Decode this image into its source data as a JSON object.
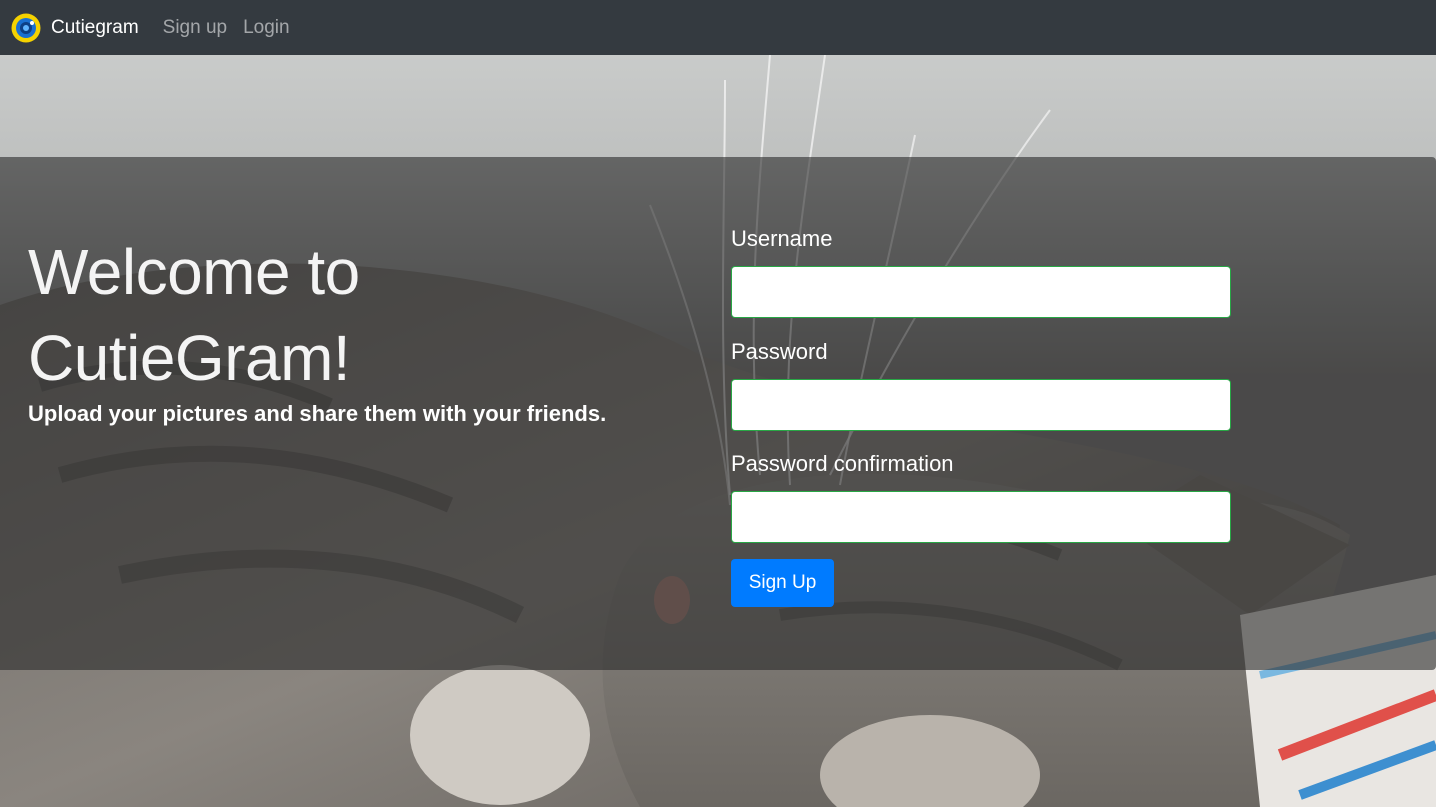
{
  "navbar": {
    "brand": "Cutiegram",
    "links": [
      "Sign up",
      "Login"
    ]
  },
  "hero": {
    "title": "Welcome to CutieGram!",
    "lead": "Upload your pictures and share them with your friends."
  },
  "form": {
    "username_label": "Username",
    "username_value": "",
    "password_label": "Password",
    "password_value": "",
    "password_confirmation_label": "Password confirmation",
    "password_confirmation_value": "",
    "submit_label": "Sign Up"
  },
  "colors": {
    "navbar_bg": "#343a40",
    "primary_button": "#007bff",
    "input_border_valid": "#28a745",
    "nav_link_muted": "rgba(255,255,255,0.55)"
  },
  "icons": {
    "brand_logo": "camera-lens-icon"
  },
  "background_image": "sleeping-tabby-cat-photo"
}
